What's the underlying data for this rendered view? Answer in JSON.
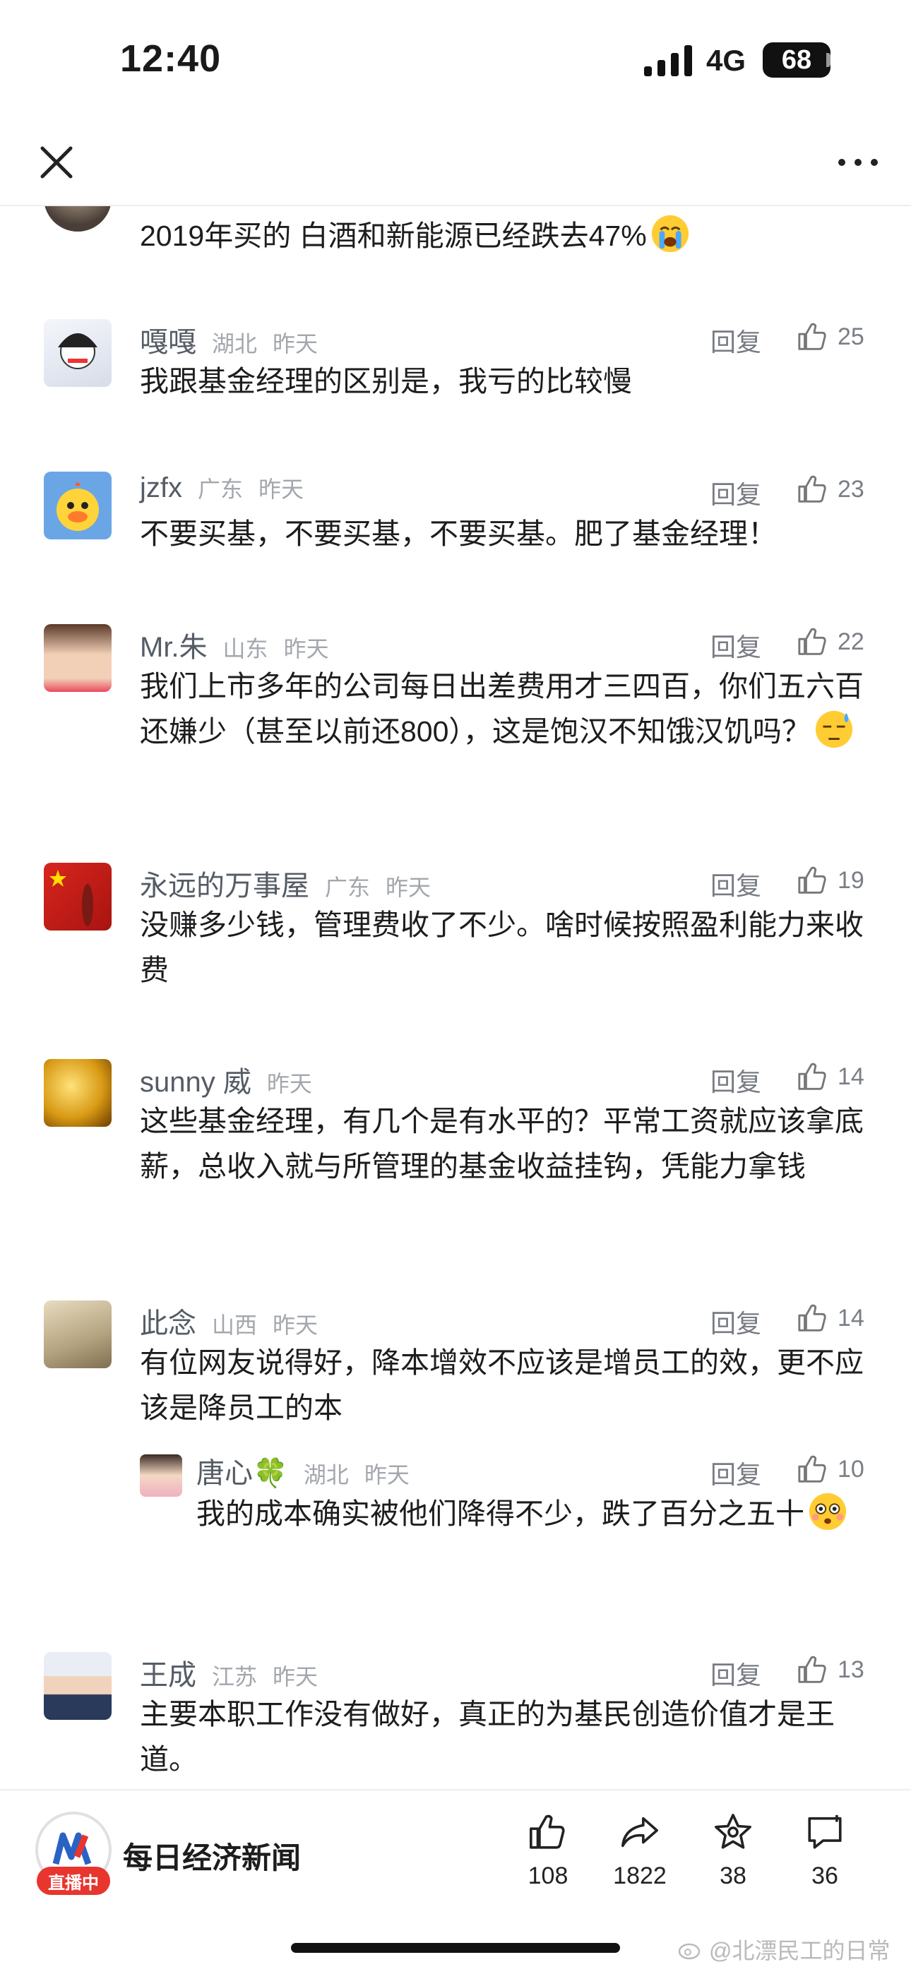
{
  "status_bar": {
    "time": "12:40",
    "network": "4G",
    "battery": "68"
  },
  "comments": [
    {
      "author": "",
      "region": "",
      "time": "",
      "text": "2019年买的 白酒和新能源已经跌去47%",
      "emoji": "crying-face",
      "reply": "",
      "likes": ""
    },
    {
      "author": "嘎嘎",
      "region": "湖北",
      "time": "昨天",
      "text": "我跟基金经理的区别是，我亏的比较慢",
      "reply": "回复",
      "likes": "25"
    },
    {
      "author": "jzfx",
      "region": "广东",
      "time": "昨天",
      "text": "不要买基，不要买基，不要买基。肥了基金经理！",
      "reply": "回复",
      "likes": "23"
    },
    {
      "author": "Mr.朱",
      "region": "山东",
      "time": "昨天",
      "text": "我们上市多年的公司每日出差费用才三四百，你们五六百还嫌少（甚至以前还800），这是饱汉不知饿汉饥吗？",
      "emoji": "sweat-face",
      "reply": "回复",
      "likes": "22"
    },
    {
      "author": "永远的万事屋",
      "region": "广东",
      "time": "昨天",
      "text": "没赚多少钱，管理费收了不少。啥时候按照盈利能力来收费",
      "reply": "回复",
      "likes": "19"
    },
    {
      "author": "sunny 威",
      "region": "",
      "time": "昨天",
      "text": "这些基金经理，有几个是有水平的？平常工资就应该拿底薪，总收入就与所管理的基金收益挂钩，凭能力拿钱",
      "reply": "回复",
      "likes": "14"
    },
    {
      "author": "此念",
      "region": "山西",
      "time": "昨天",
      "text": "有位网友说得好，降本增效不应该是增员工的效，更不应该是降员工的本",
      "reply": "回复",
      "likes": "14",
      "sub_reply": {
        "author": "唐心🍀",
        "region": "湖北",
        "time": "昨天",
        "text": "我的成本确实被他们降得不少，跌了百分之五十",
        "emoji": "flushed-face",
        "reply": "回复",
        "likes": "10"
      }
    },
    {
      "author": "王成",
      "region": "江苏",
      "time": "昨天",
      "text": "主要本职工作没有做好，真正的为基民创造价值才是王道。",
      "reply": "回复",
      "likes": "13"
    }
  ],
  "bottom_bar": {
    "source_name": "每日经济新闻",
    "live_label": "直播中",
    "likes": "108",
    "shares": "1822",
    "favorites": "38",
    "comments": "36"
  },
  "watermark": "@北漂民工的日常",
  "colors": {
    "accent_red": "#e8352e",
    "meta_gray": "#a3a7ad"
  }
}
